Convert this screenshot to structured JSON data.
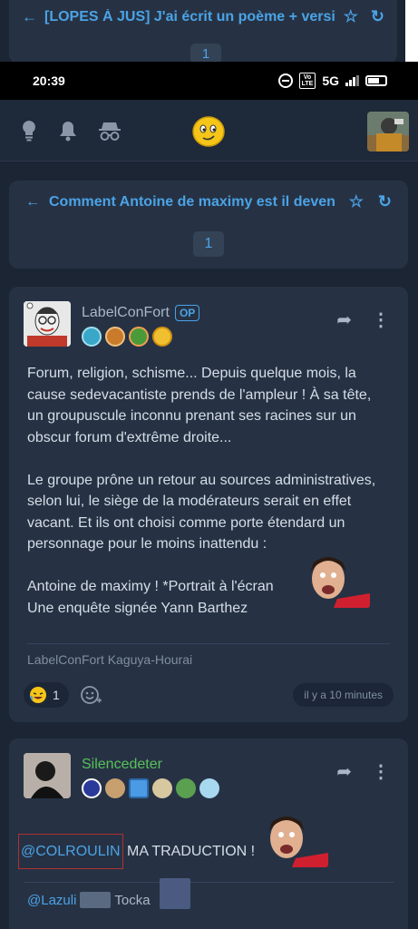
{
  "ghost": {
    "title": "[LOPES À JUS] J'ai écrit un poème + versi",
    "page": "1"
  },
  "status_bar": {
    "time": "20:39",
    "volte": "Vo LTE",
    "network": "5G"
  },
  "header": {
    "icons": [
      "lightbulb-icon",
      "bell-icon",
      "spy-icon"
    ],
    "logo": "smiley-logo"
  },
  "topic": {
    "title": "Comment Antoine de maximy est il deven",
    "page": "1"
  },
  "post1": {
    "author": "LabelConFort",
    "op_label": "OP",
    "para1": "Forum, religion, schisme... Depuis quelque mois, la cause sedevacantiste prends de l'ampleur ! À sa tête, un groupuscule inconnu prenant ses racines sur un obscur forum d'extrême droite...",
    "para2": "Le groupe prône un retour au sources administratives, selon lui, le siège de la modérateurs serait en effet vacant. Et ils ont choisi comme porte étendard un personnage pour le moins inattendu :",
    "line3": "Antoine de maximy ! *Portrait à l'écran",
    "line3_end": "*",
    "line4": "Une enquête signée Yann Barthez",
    "signature": "LabelConFort Kaguya-Hourai",
    "reaction_count": "1",
    "time": "il y a 10 minutes"
  },
  "post2": {
    "author": "Silencedeter",
    "mention": "@COLROULIN",
    "text": " MA TRADUCTION !",
    "quote_mention": "@Lazuli",
    "quote_text": "Tocka"
  },
  "colors": {
    "accent": "#4ba3e6",
    "background": "#1b2533",
    "card": "#263244",
    "green_author": "#58c15a"
  }
}
